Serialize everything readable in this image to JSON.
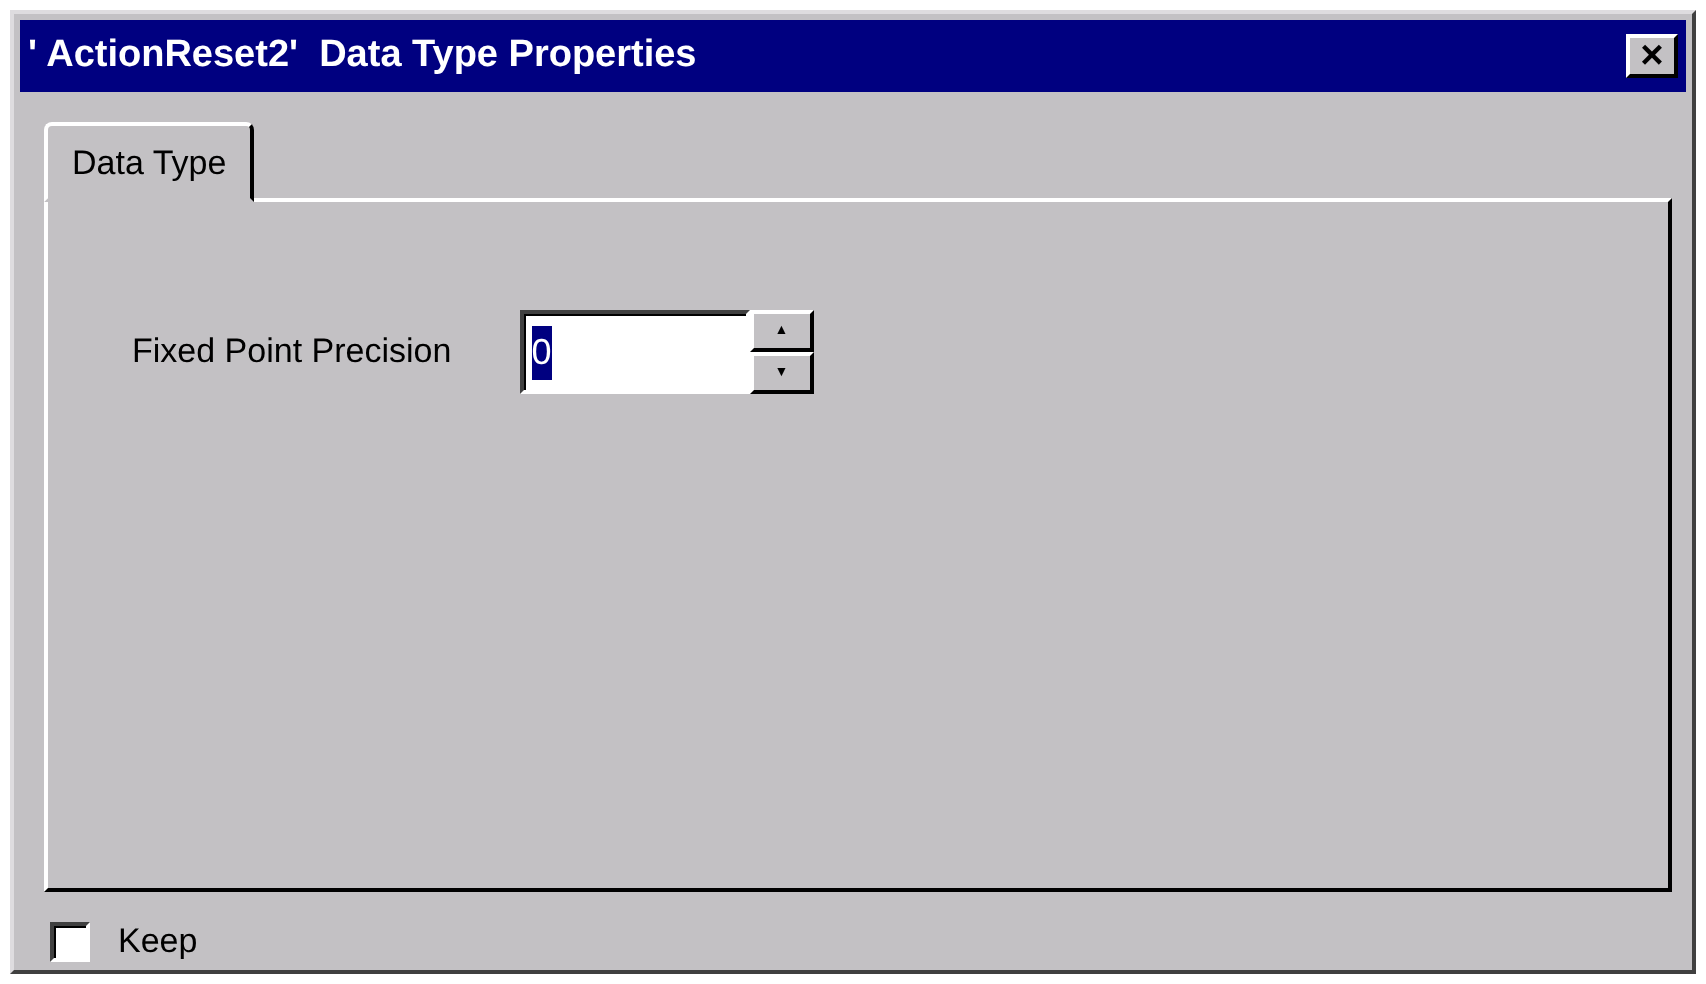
{
  "window": {
    "title": "' ActionReset2'  Data Type Properties",
    "close": "×"
  },
  "tabs": [
    {
      "label": "Data Type",
      "selected": true
    }
  ],
  "fields": [
    {
      "label": "Fixed Point Precision",
      "value": "0",
      "value_selected": true,
      "up": "▲",
      "down": "▼"
    }
  ],
  "keep": {
    "label": "Keep",
    "checked": false
  }
}
